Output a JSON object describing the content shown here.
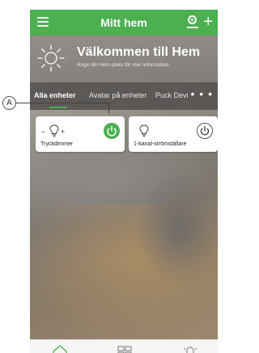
{
  "header": {
    "title": "Mitt hem"
  },
  "welcome": {
    "title": "Välkommen till Hem",
    "subtitle": "Ange din Hem-plats för mer information."
  },
  "tabs": [
    {
      "label": "Alla enheter"
    },
    {
      "label": "Avatar på enheter"
    },
    {
      "label": "Puck Devi"
    }
  ],
  "tabs_more": "• • •",
  "devices": [
    {
      "label": "Tryckdimmer",
      "state": "on"
    },
    {
      "label": "1-kanal-strömställare",
      "state": "off"
    }
  ],
  "annotation": {
    "label": "A"
  },
  "colors": {
    "accent": "#4caf50"
  }
}
